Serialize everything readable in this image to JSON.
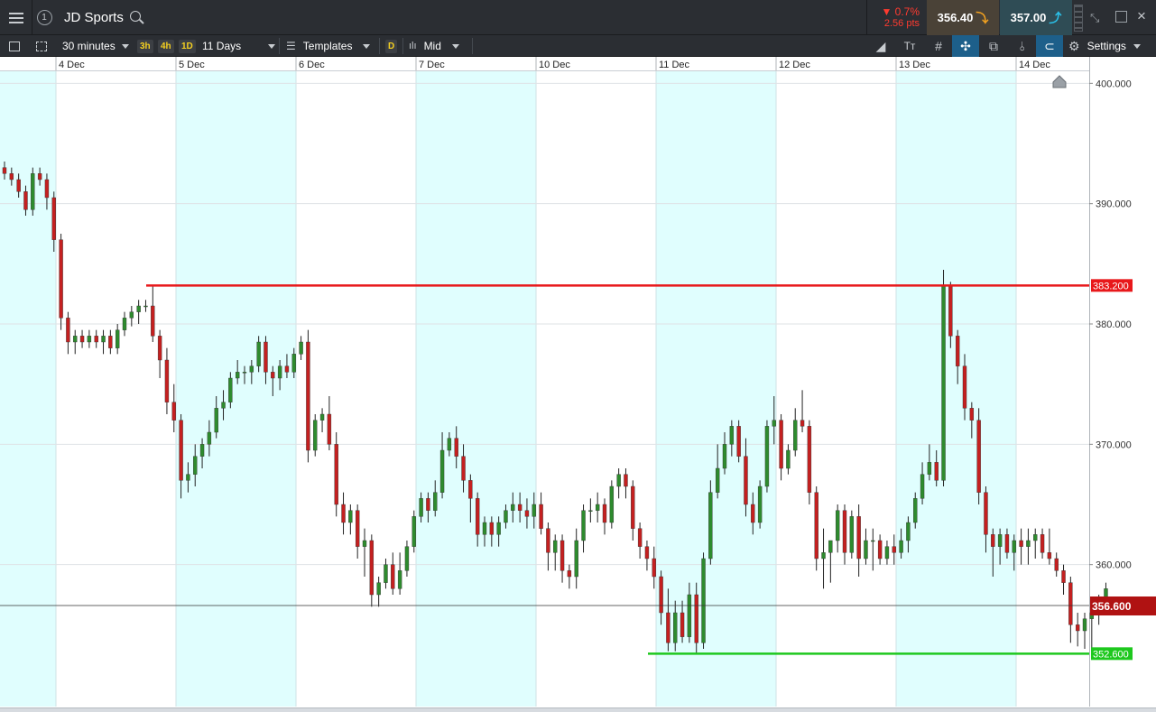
{
  "header": {
    "instrument": "JD Sports",
    "change_pct": "▼ 0.7%",
    "change_pts": "2.56 pts",
    "sell_price": "356.40",
    "buy_price": "357.00",
    "info_label": "1"
  },
  "toolbar": {
    "interval": "30 minutes",
    "quick_intervals": [
      "3h",
      "4h",
      "1D"
    ],
    "range": "11 Days",
    "templates": "Templates",
    "d_badge": "D",
    "price_mode": "Mid",
    "settings": "Settings"
  },
  "colors": {
    "up": "#2e8b2e",
    "down": "#c42020",
    "session_shade": "#e0fefe",
    "resistance": "#e8181b",
    "support": "#1ec81e"
  },
  "chart_data": {
    "type": "candlestick",
    "ylim": [
      348.2,
      401.0
    ],
    "y_ticks": [
      "400.000",
      "390.000",
      "380.000",
      "370.000",
      "360.000"
    ],
    "y_tick_values": [
      400,
      390,
      380,
      370,
      360
    ],
    "x_labels": [
      "4 Dec",
      "5 Dec",
      "6 Dec",
      "7 Dec",
      "10 Dec",
      "11 Dec",
      "12 Dec",
      "13 Dec",
      "14 Dec"
    ],
    "bars_per_session": 17,
    "current_price": 356.6,
    "current_price_label": "356.600",
    "resistance": 383.2,
    "resistance_label": "383.200",
    "support": 352.6,
    "support_label": "352.600",
    "candles": [
      [
        393,
        393.5,
        392,
        392.5
      ],
      [
        392.5,
        393,
        391.5,
        392
      ],
      [
        392,
        392.5,
        390.5,
        391
      ],
      [
        391,
        391.5,
        389,
        389.5
      ],
      [
        389.5,
        393,
        389,
        392.5
      ],
      [
        392.5,
        393,
        391.5,
        392
      ],
      [
        392,
        392.5,
        389.5,
        390.5
      ],
      [
        390.5,
        391,
        386,
        387
      ],
      [
        387,
        387.5,
        379.5,
        380.5
      ],
      [
        380.5,
        381,
        377.5,
        378.5
      ],
      [
        378.5,
        379.5,
        377.5,
        379
      ],
      [
        379,
        379.5,
        378,
        378.5
      ],
      [
        378.5,
        379.5,
        378,
        379
      ],
      [
        379,
        379.5,
        378,
        378.5
      ],
      [
        378.5,
        379.5,
        377.5,
        379
      ],
      [
        379,
        379.5,
        377.5,
        378
      ],
      [
        378,
        380,
        377.5,
        379.5
      ],
      [
        379.5,
        381,
        379,
        380.5
      ],
      [
        380.5,
        381.5,
        379.8,
        381
      ],
      [
        381,
        382,
        380,
        381.5
      ],
      [
        381.5,
        382,
        381,
        381.5
      ],
      [
        381.5,
        383.2,
        378.5,
        379
      ],
      [
        379,
        379.5,
        375.5,
        377
      ],
      [
        377,
        378,
        372.5,
        373.5
      ],
      [
        373.5,
        375,
        371,
        372
      ],
      [
        372,
        372.5,
        365.5,
        367
      ],
      [
        367,
        368.5,
        366,
        367.5
      ],
      [
        367.5,
        370,
        366.5,
        369
      ],
      [
        369,
        370.5,
        368,
        370
      ],
      [
        370,
        372,
        369,
        371
      ],
      [
        371,
        374,
        370.5,
        373
      ],
      [
        373,
        374.5,
        372,
        373.5
      ],
      [
        373.5,
        376,
        373,
        375.5
      ],
      [
        375.5,
        377,
        375,
        376
      ],
      [
        376,
        376.5,
        375,
        376
      ],
      [
        376,
        377,
        375,
        376.5
      ],
      [
        376.5,
        379,
        376,
        378.5
      ],
      [
        378.5,
        379,
        375,
        376
      ],
      [
        376,
        376.5,
        374,
        375.5
      ],
      [
        375.5,
        377,
        374.5,
        376.5
      ],
      [
        376.5,
        377.5,
        375.5,
        376
      ],
      [
        376,
        378,
        375.5,
        377.5
      ],
      [
        377.5,
        379,
        377,
        378.5
      ],
      [
        378.5,
        379.5,
        368.5,
        369.5
      ],
      [
        369.5,
        372.5,
        369,
        372
      ],
      [
        372,
        373,
        371,
        372.5
      ],
      [
        372.5,
        374,
        369.5,
        370
      ],
      [
        370,
        371,
        364,
        365
      ],
      [
        365,
        366,
        362.5,
        363.5
      ],
      [
        363.5,
        365,
        362.5,
        364.5
      ],
      [
        364.5,
        365,
        360.5,
        361.5
      ],
      [
        361.5,
        363,
        359,
        362
      ],
      [
        362,
        362.5,
        356.5,
        357.5
      ],
      [
        357.5,
        359,
        356.5,
        358.5
      ],
      [
        358.5,
        360.5,
        358,
        360
      ],
      [
        360,
        361,
        357.5,
        358
      ],
      [
        358,
        361,
        357.5,
        359.5
      ],
      [
        359.5,
        362,
        359,
        361.5
      ],
      [
        361.5,
        364.5,
        361,
        364
      ],
      [
        364,
        366,
        363.5,
        365.5
      ],
      [
        365.5,
        366,
        363.5,
        364.5
      ],
      [
        364.5,
        367,
        364,
        366
      ],
      [
        366,
        371,
        365.5,
        369.5
      ],
      [
        369.5,
        371,
        369,
        370.5
      ],
      [
        370.5,
        371.5,
        368,
        369
      ],
      [
        369,
        370,
        366,
        367
      ],
      [
        367,
        367.5,
        363.5,
        365.5
      ],
      [
        365.5,
        366,
        361.5,
        362.5
      ],
      [
        362.5,
        364,
        361.5,
        363.5
      ],
      [
        363.5,
        364,
        361.5,
        362.5
      ],
      [
        362.5,
        364,
        361.5,
        363.5
      ],
      [
        363.5,
        365,
        363,
        364.5
      ],
      [
        364.5,
        366,
        363.5,
        365
      ],
      [
        365,
        366,
        363.5,
        364.5
      ],
      [
        364.5,
        365.5,
        363,
        364
      ],
      [
        364,
        366,
        363,
        365
      ],
      [
        365,
        366,
        362.5,
        363
      ],
      [
        363,
        363.5,
        359.5,
        361
      ],
      [
        361,
        362.5,
        359.5,
        362
      ],
      [
        362,
        362.5,
        358.5,
        359.5
      ],
      [
        359.5,
        360,
        358,
        359
      ],
      [
        359,
        363,
        358,
        362
      ],
      [
        362,
        365,
        361,
        364.5
      ],
      [
        364.5,
        365.5,
        363.5,
        364.5
      ],
      [
        364.5,
        366,
        363.5,
        365
      ],
      [
        365,
        365.5,
        362.5,
        363.5
      ],
      [
        363.5,
        367,
        363,
        366.5
      ],
      [
        366.5,
        368,
        365.5,
        367.5
      ],
      [
        367.5,
        368,
        365.5,
        366.5
      ],
      [
        366.5,
        367,
        362,
        363
      ],
      [
        363,
        363.5,
        360.5,
        361.5
      ],
      [
        361.5,
        362,
        359.5,
        360.5
      ],
      [
        360.5,
        361.5,
        358,
        359
      ],
      [
        359,
        359.5,
        355,
        356
      ],
      [
        356,
        358,
        352.8,
        353.5
      ],
      [
        353.5,
        357,
        352.8,
        356
      ],
      [
        356,
        357,
        353.5,
        354
      ],
      [
        354,
        358.5,
        353.5,
        357.5
      ],
      [
        357.5,
        358.5,
        352.6,
        353.5
      ],
      [
        353.5,
        361,
        353,
        360.5
      ],
      [
        360.5,
        367,
        360,
        366
      ],
      [
        366,
        370,
        365.5,
        368
      ],
      [
        368,
        371,
        367.5,
        370
      ],
      [
        370,
        372,
        369,
        371.5
      ],
      [
        371.5,
        372,
        368.5,
        369
      ],
      [
        369,
        370.5,
        364,
        365
      ],
      [
        365,
        366,
        362.5,
        363.5
      ],
      [
        363.5,
        367,
        363,
        366.5
      ],
      [
        366.5,
        372,
        366,
        371.5
      ],
      [
        371.5,
        374,
        370,
        372
      ],
      [
        372,
        372.5,
        367,
        368
      ],
      [
        368,
        370,
        367.5,
        369.5
      ],
      [
        369.5,
        373,
        369,
        372
      ],
      [
        372,
        374.5,
        371,
        371.5
      ],
      [
        371.5,
        372,
        365,
        366
      ],
      [
        366,
        366.5,
        359.5,
        360.5
      ],
      [
        360.5,
        363,
        358,
        361
      ],
      [
        361,
        362,
        358.5,
        362
      ],
      [
        362,
        365,
        361,
        364.5
      ],
      [
        364.5,
        365,
        360,
        361
      ],
      [
        361,
        364.5,
        360.5,
        364
      ],
      [
        364,
        365,
        359,
        360.5
      ],
      [
        360.5,
        363,
        360,
        362
      ],
      [
        362,
        363,
        359.5,
        362
      ],
      [
        362,
        362.5,
        360,
        360.5
      ],
      [
        360.5,
        362,
        360,
        361.5
      ],
      [
        361.5,
        362.5,
        360,
        361
      ],
      [
        361,
        363,
        360.5,
        362
      ],
      [
        362,
        364,
        361,
        363.5
      ],
      [
        363.5,
        366,
        363,
        365.5
      ],
      [
        365.5,
        368.5,
        365,
        367.5
      ],
      [
        367.5,
        370,
        367,
        368.5
      ],
      [
        368.5,
        369.5,
        366.5,
        367
      ],
      [
        367,
        384.5,
        366.5,
        383.2
      ],
      [
        383.2,
        383.5,
        378,
        379
      ],
      [
        379,
        379.5,
        375,
        376.5
      ],
      [
        376.5,
        377.5,
        372,
        373
      ],
      [
        373,
        373.5,
        370.5,
        372
      ],
      [
        372,
        373,
        365,
        366
      ],
      [
        366,
        366.5,
        361,
        362.5
      ],
      [
        362.5,
        363,
        359,
        361.5
      ],
      [
        361.5,
        363,
        360,
        362.5
      ],
      [
        362.5,
        363,
        360.5,
        361
      ],
      [
        361,
        362.5,
        359.5,
        362
      ],
      [
        362,
        363,
        360,
        361.5
      ],
      [
        361.5,
        363,
        360,
        362
      ],
      [
        362,
        363,
        360.5,
        362.5
      ],
      [
        362.5,
        363,
        360.5,
        361
      ],
      [
        361,
        363,
        360,
        360.5
      ],
      [
        360.5,
        361,
        359,
        359.5
      ],
      [
        359.5,
        360,
        357.5,
        358.5
      ],
      [
        358.5,
        359,
        353.5,
        355
      ],
      [
        355,
        356,
        353.2,
        354.5
      ],
      [
        354.5,
        356,
        353,
        355.5
      ],
      [
        355.5,
        356.5,
        352.8,
        356
      ],
      [
        356,
        357.5,
        355,
        357
      ],
      [
        357,
        358.5,
        356,
        358
      ]
    ]
  }
}
